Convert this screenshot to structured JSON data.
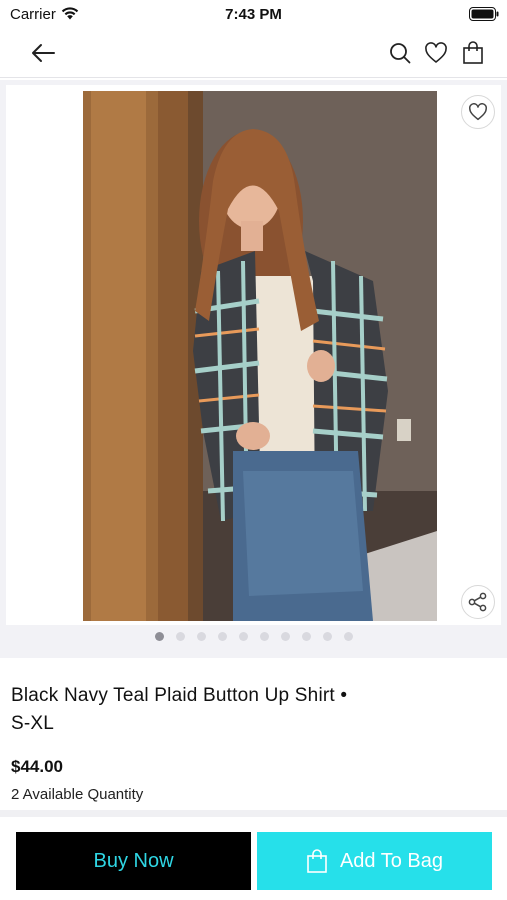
{
  "status_bar": {
    "carrier": "Carrier",
    "time": "7:43 PM",
    "icons": [
      "wifi-icon",
      "battery-icon"
    ]
  },
  "nav": {
    "icons": [
      "back-arrow-icon",
      "search-icon",
      "heart-icon",
      "shopping-bag-icon"
    ]
  },
  "gallery": {
    "image_description_icon": "product-photo",
    "dot_count": 10,
    "active_dot": 0,
    "overlay_icons": [
      "heart-icon",
      "share-icon"
    ]
  },
  "product": {
    "title": "Black Navy Teal Plaid Button Up Shirt • S-XL",
    "price": "$44.00",
    "quantity": "2 Available Quantity"
  },
  "actions": {
    "buy_now": "Buy Now",
    "add_to_bag": "Add To Bag"
  },
  "colors": {
    "accent": "#26e0ea",
    "buy_now_bg": "#000000",
    "buy_now_text": "#2fd6e4"
  }
}
